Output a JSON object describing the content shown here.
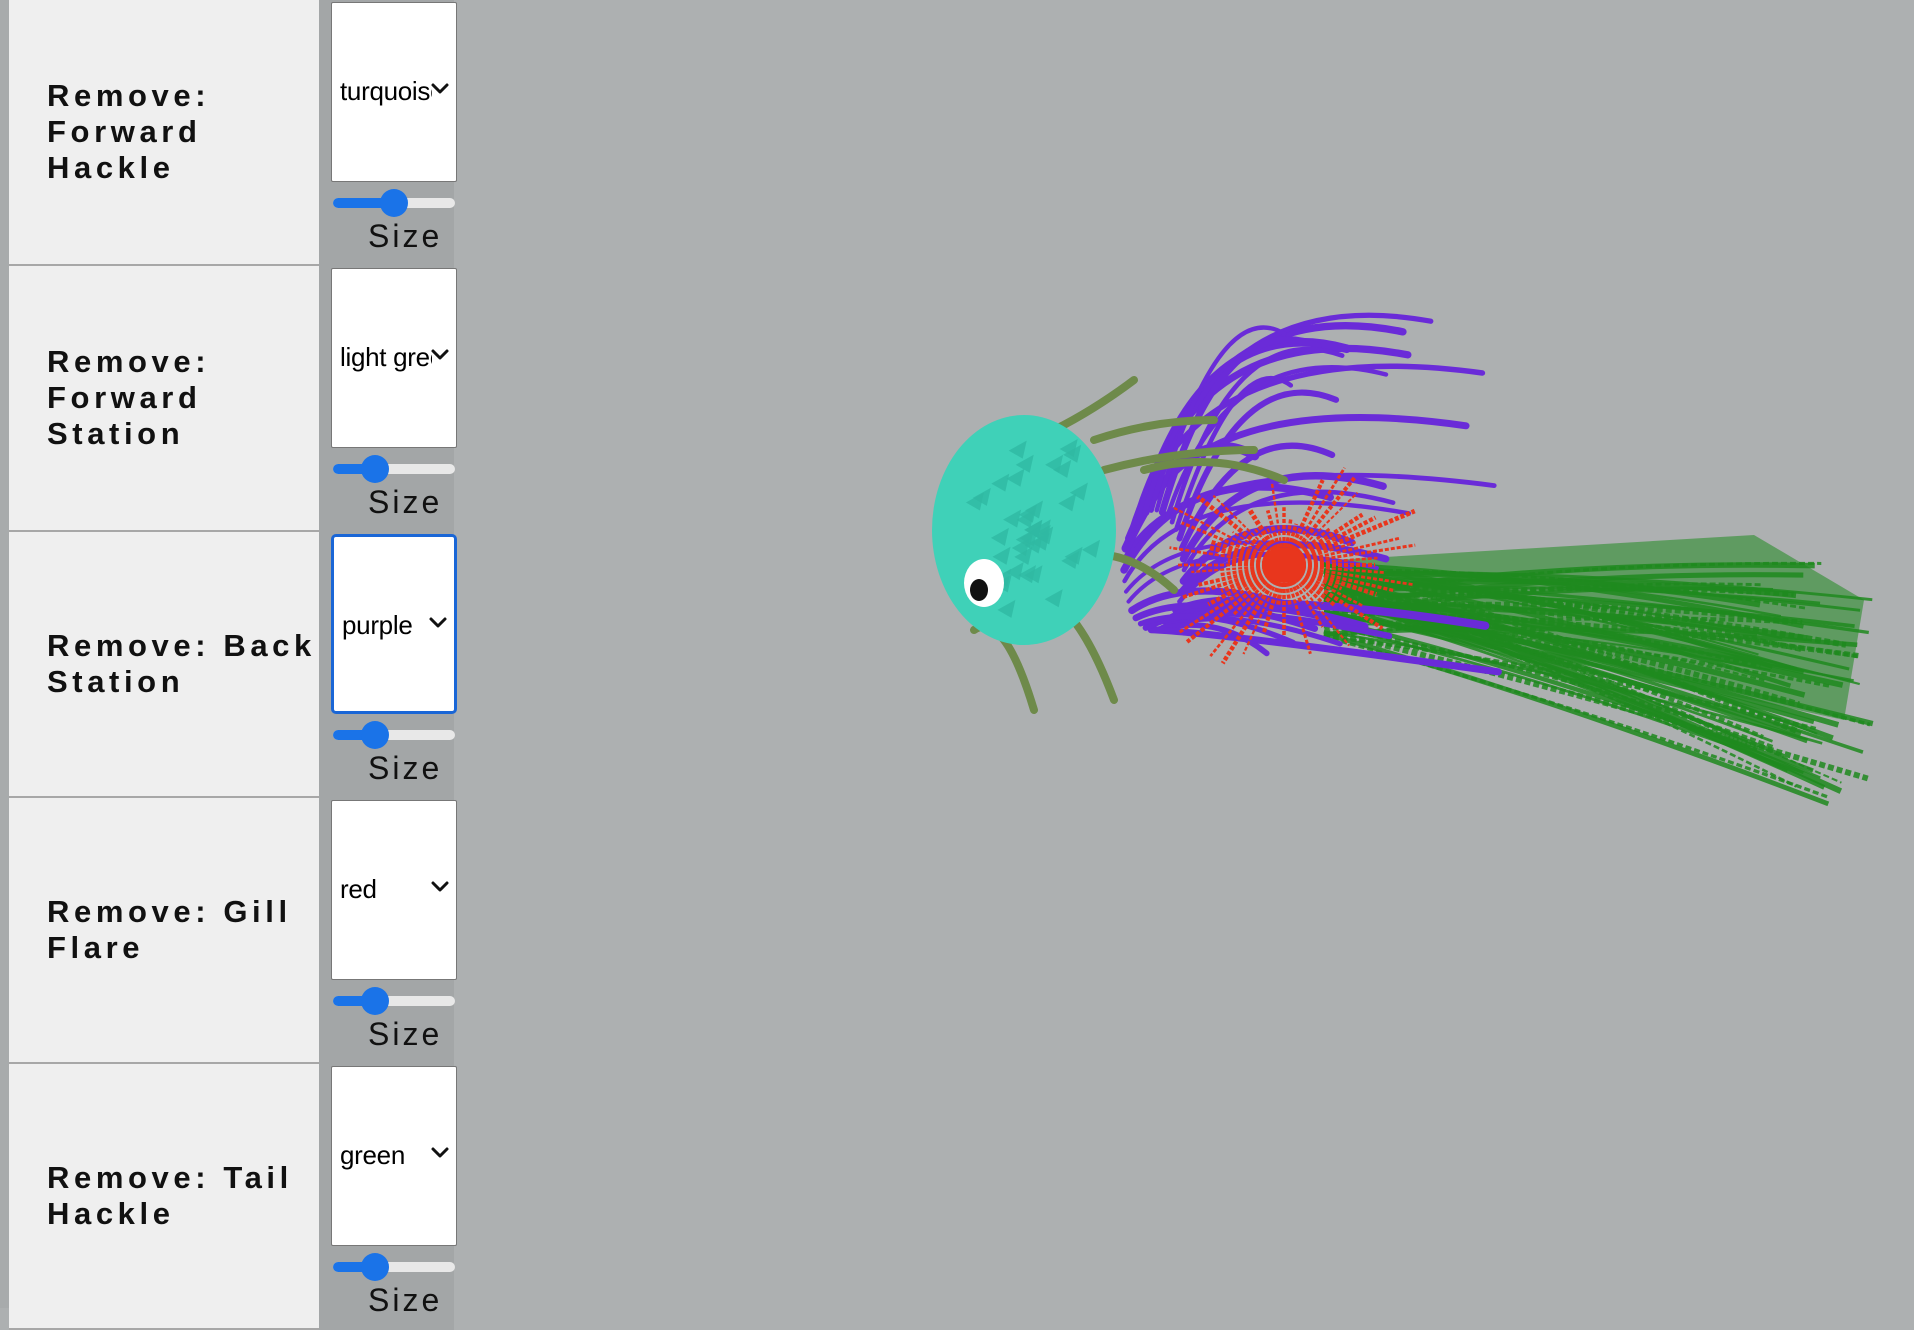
{
  "controls": [
    {
      "label": "Remove: Forward Hackle",
      "color": "turquoise",
      "size_fraction": 0.5,
      "size_label": "Size"
    },
    {
      "label": "Remove: Forward Station",
      "color": "light green",
      "size_fraction": 0.3,
      "size_label": "Size"
    },
    {
      "label": "Remove: Back Station",
      "color": "purple",
      "size_fraction": 0.3,
      "size_label": "Size"
    },
    {
      "label": "Remove: Gill Flare",
      "color": "red",
      "size_fraction": 0.3,
      "size_label": "Size"
    },
    {
      "label": "Remove: Tail Hackle",
      "color": "green",
      "size_fraction": 0.3,
      "size_label": "Size"
    }
  ],
  "colors": {
    "turquoise": "#3fd1b8",
    "light_green": "#6e8a4a",
    "purple": "#6a2bd8",
    "red": "#e8361d",
    "green": "#1f8a1f",
    "eye": "#ffffff",
    "pupil": "#111111"
  }
}
